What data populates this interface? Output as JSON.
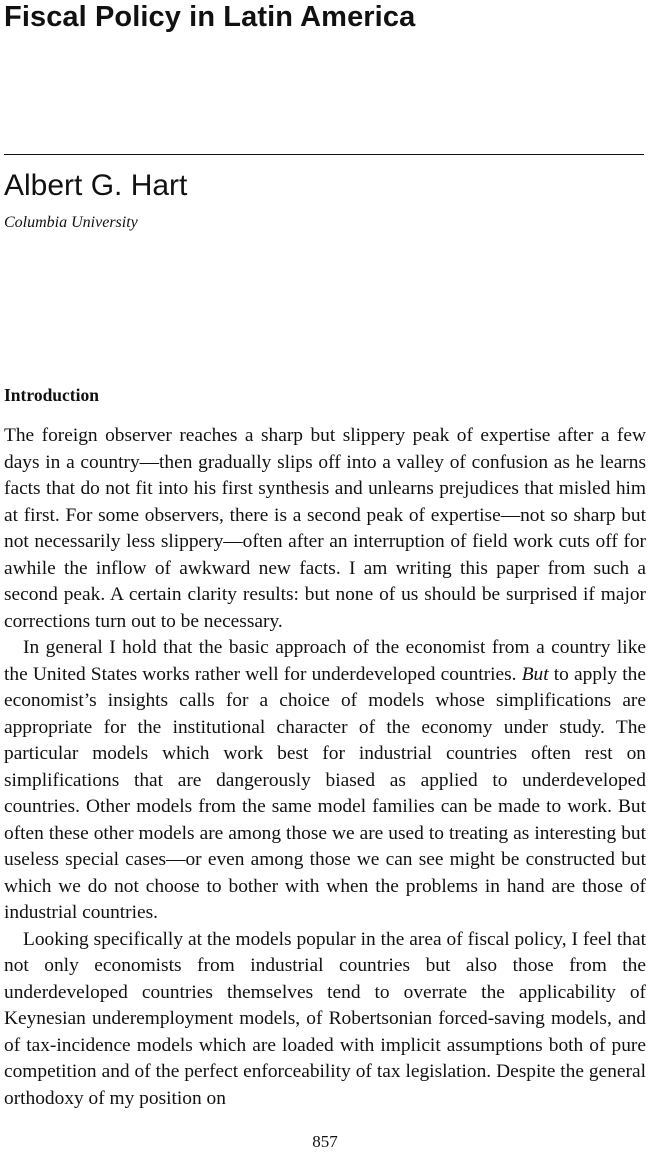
{
  "article": {
    "title": "Fiscal Policy in Latin America",
    "author": "Albert G. Hart",
    "affiliation": "Columbia University"
  },
  "section": {
    "heading": "Introduction",
    "paragraphs": [
      {
        "text": "The foreign observer reaches a sharp but slippery peak of expertise after a few days in a country—then gradually slips off into a valley of confusion as he learns facts that do not fit into his first synthesis and unlearns prejudices that misled him at first. For some observers, there is a second peak of expertise—not so sharp but not necessarily less slippery—often after an interruption of field work cuts off for awhile the inflow of awkward new facts. I am writing this paper from such a second peak. A certain clarity results: but none of us should be surprised if major corrections turn out to be necessary."
      },
      {
        "text_before_emphasis": "In general I hold that the basic approach of the economist from a country like the United States works rather well for underdeveloped countries. ",
        "emphasis": "But",
        "text_after_emphasis": " to apply the economist’s insights calls for a choice of models whose simplifications are appropriate for the institutional character of the economy under study. The particular models which work best for industrial countries often rest on simplifications that are dangerously biased as applied to underdeveloped countries. Other models from the same model families can be made to work. But often these other models are among those we are used to treating as interesting but useless special cases—or even among those we can see might be constructed but which we do not choose to bother with when the problems in hand are those of industrial countries."
      },
      {
        "text": "Looking specifically at the models popular in the area of fiscal policy, I feel that not only economists from industrial countries but also those from the underdeveloped countries themselves tend to overrate the applicability of Keynesian underemployment models, of Robertsonian forced-saving models, and of tax-incidence models which are loaded with implicit assumptions both of pure competition and of the perfect enforceability of tax legislation. Despite the general orthodoxy of my position on"
      }
    ]
  },
  "footer": {
    "page_number": "857"
  }
}
